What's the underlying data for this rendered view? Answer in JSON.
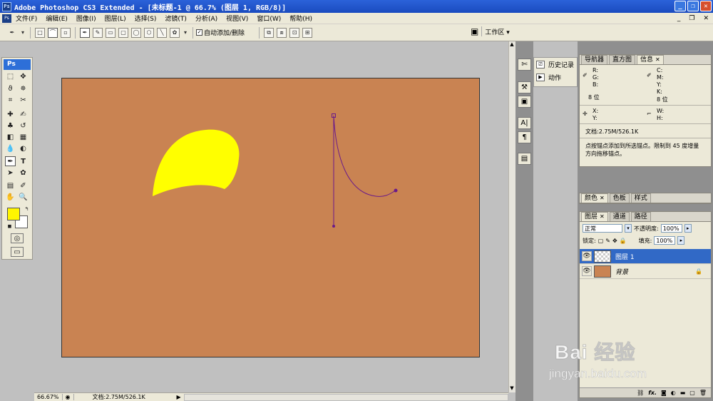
{
  "window": {
    "title": "Adobe Photoshop CS3 Extended - [未标题-1 @ 66.7% (图层 1, RGB/8)]",
    "app_icon": "Ps",
    "controls": {
      "minimize": "_",
      "restore": "❐",
      "close": "✕"
    }
  },
  "menu": {
    "items": [
      "文件(F)",
      "编辑(E)",
      "图像(I)",
      "图层(L)",
      "选择(S)",
      "滤镜(T)",
      "分析(A)",
      "视图(V)",
      "窗口(W)",
      "帮助(H)"
    ],
    "doc_controls": {
      "minimize": "_",
      "restore": "❐",
      "close": "✕"
    }
  },
  "options": {
    "auto_add_delete_label": "自动添加/删除",
    "auto_add_delete_checked": true,
    "workspace_label": "工作区 ▾"
  },
  "toolbox": {
    "logo": "Ps",
    "colors": {
      "foreground": "#fff500",
      "background": "#ffffff"
    }
  },
  "canvas": {
    "background_color": "#c98352",
    "shape_fill": "#ffff00",
    "path_color": "#6a1a8a"
  },
  "status": {
    "zoom": "66.67%",
    "doc_info": "文档:2.75M/526.1K"
  },
  "history_panel": {
    "items": [
      {
        "label": "历史记录",
        "icon": "history-icon"
      },
      {
        "label": "动作",
        "icon": "actions-icon"
      }
    ]
  },
  "info_panel": {
    "tabs": [
      "导航器",
      "直方图",
      "信息"
    ],
    "active_tab": "信息",
    "rgb_labels": [
      "R:",
      "G:",
      "B:"
    ],
    "cmyk_labels": [
      "C:",
      "M:",
      "Y:",
      "K:"
    ],
    "bit_left": "8 位",
    "bit_right": "8 位",
    "xy_labels": [
      "X:",
      "Y:"
    ],
    "wh_labels": [
      "W:",
      "H:"
    ],
    "doc_size": "文档:2.75M/526.1K",
    "hint_line1": "点按锚点添加到所选锚点。限制到 45 度增量",
    "hint_line2": "方向拖移锚点。"
  },
  "color_panel": {
    "tabs": [
      "颜色",
      "色板",
      "样式"
    ]
  },
  "layers_panel": {
    "tabs": [
      "图层",
      "通道",
      "路径"
    ],
    "blend_mode": "正常",
    "opacity_label": "不透明度:",
    "opacity_value": "100%",
    "lock_label": "锁定:",
    "fill_label": "填充:",
    "fill_value": "100%",
    "layers": [
      {
        "name": "图层 1",
        "selected": true,
        "thumb": "transparent",
        "locked": false
      },
      {
        "name": "背景",
        "selected": false,
        "thumb": "#c98352",
        "locked": true
      }
    ],
    "footer_icons": [
      "link-icon",
      "fx-icon",
      "mask-icon",
      "adjustment-icon",
      "group-icon",
      "new-layer-icon",
      "trash-icon"
    ]
  },
  "watermark": {
    "text": "Bai 经验",
    "url": "jingyan.baidu.com"
  }
}
